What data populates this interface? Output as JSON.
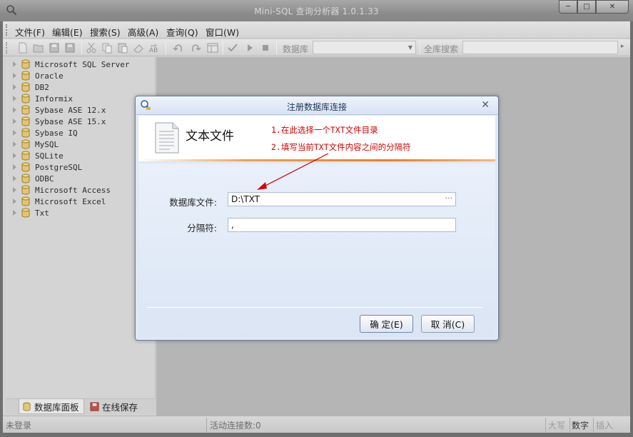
{
  "window": {
    "title": "Mini-SQL 查询分析器 1.0.1.33",
    "min_glyph": "─",
    "max_glyph": "□",
    "close_glyph": "✕"
  },
  "menu": [
    "文件(F)",
    "编辑(E)",
    "搜索(S)",
    "高级(A)",
    "查询(Q)",
    "窗口(W)"
  ],
  "toolbar": {
    "db_label": "数据库",
    "db_value": "",
    "search_label": "全库搜索",
    "search_value": ""
  },
  "tree": [
    "Microsoft SQL Server",
    "Oracle",
    "DB2",
    "Informix",
    "Sybase ASE 12.x",
    "Sybase ASE 15.x",
    "Sybase IQ",
    "MySQL",
    "SQLite",
    "PostgreSQL",
    "ODBC",
    "Microsoft Access",
    "Microsoft Excel",
    "Txt"
  ],
  "panel_tabs": [
    "数据库面板",
    "在线保存"
  ],
  "status": {
    "login": "未登录",
    "connections": "活动连接数:0",
    "caps": "大写",
    "num": "数字",
    "insert": "插入"
  },
  "dialog": {
    "title": "注册数据库连接",
    "close_glyph": "✕",
    "heading": "文本文件",
    "note1": "1.在此选择一个TXT文件目录",
    "note2": "2.填写当前TXT文件内容之间的分隔符",
    "file_label": "数据库文件:",
    "file_value": "D:\\TXT",
    "file_browse": "···",
    "sep_label": "分隔符:",
    "sep_value": ",",
    "ok_label": "确 定(E)",
    "cancel_label": "取 消(C)"
  },
  "colors": {
    "note_red": "#d40000",
    "header_accent": "#f08c1e"
  }
}
